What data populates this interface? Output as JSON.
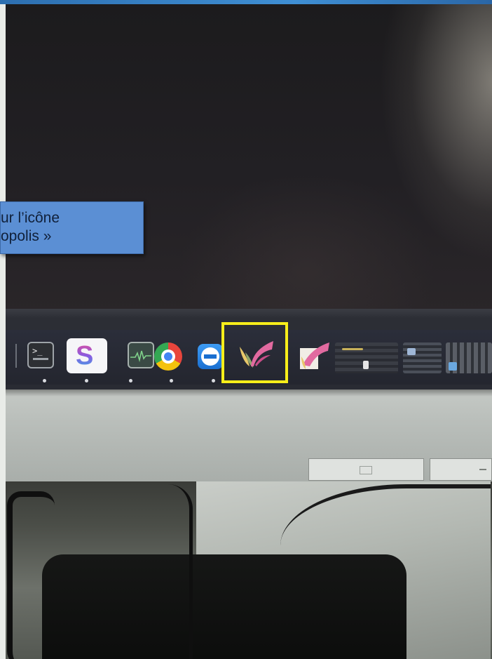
{
  "callout": {
    "line1": "ur l’icône",
    "line2": "opolis »"
  },
  "dock": {
    "apps": [
      {
        "name": "terminal",
        "icon": "terminal-icon",
        "glyph": ">_"
      },
      {
        "name": "stack",
        "icon": "stack-s-icon",
        "glyph": "S"
      },
      {
        "name": "system-monitor",
        "icon": "system-monitor-icon"
      },
      {
        "name": "chrome",
        "icon": "chrome-icon"
      },
      {
        "name": "teamviewer",
        "icon": "teamviewer-icon"
      },
      {
        "name": "highlighted-app",
        "icon": "pink-swoosh-icon",
        "highlighted": true
      },
      {
        "name": "app-swoosh-2",
        "icon": "pink-swoosh-icon"
      }
    ]
  },
  "colors": {
    "highlight": "#f7ee1a",
    "callout_bg": "#5b8fd4",
    "slide_border": "#3f8fd4"
  }
}
